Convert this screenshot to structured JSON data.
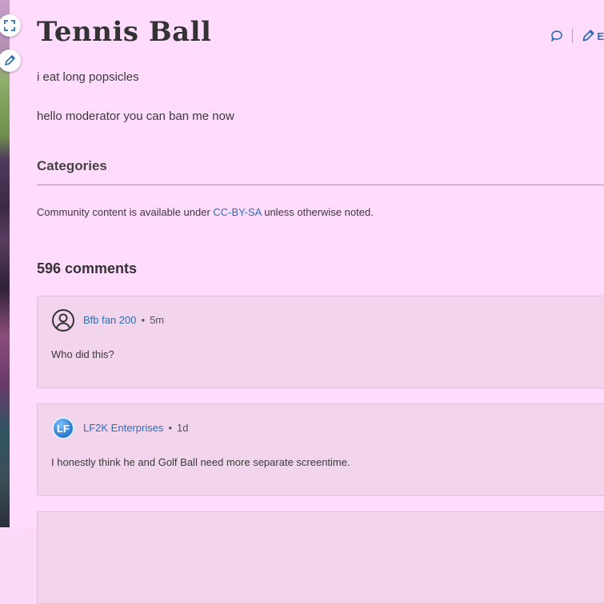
{
  "page": {
    "title": "Tennis Ball",
    "paragraphs": [
      "i eat long popsicles",
      "hello moderator you can ban me now"
    ],
    "edit_label": "E"
  },
  "categories": {
    "heading": "Categories"
  },
  "license": {
    "prefix": "Community content is available under ",
    "link": "CC-BY-SA",
    "suffix": " unless otherwise noted."
  },
  "comments": {
    "count_label": "596 comments",
    "items": [
      {
        "author": "Bfb fan 200",
        "time": "5m",
        "body": "Who did this?",
        "avatar": "user-circle-icon"
      },
      {
        "author": "LF2K Enterprises",
        "time": "1d",
        "body": "I honestly think he and Golf Ball need more separate screentime.",
        "avatar": "lf2k-avatar",
        "avatar_text": "LF"
      }
    ]
  },
  "colors": {
    "background": "#ffdbfd",
    "link": "#2a6fb5",
    "comment_bg": "#f2d4ec"
  }
}
